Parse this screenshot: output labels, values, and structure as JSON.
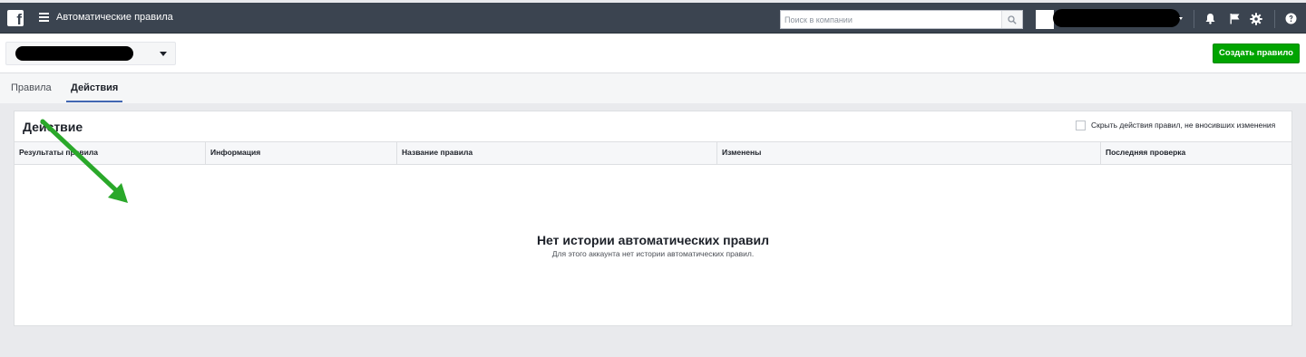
{
  "topbar": {
    "logo_letter": "f",
    "app_title": "Автоматические правила",
    "search_placeholder": "Поиск в компании"
  },
  "account_bar": {
    "create_button": "Создать правило"
  },
  "tabs": [
    {
      "label": "Правила",
      "active": false
    },
    {
      "label": "Действия",
      "active": true
    }
  ],
  "panel": {
    "title": "Действие",
    "hide_option": "Скрыть действия правил, не вносивших изменения",
    "columns": [
      "Результаты правила",
      "Информация",
      "Название правила",
      "Изменены",
      "Последняя проверка"
    ],
    "empty_title": "Нет истории автоматических правил",
    "empty_subtitle": "Для этого аккаунта нет истории автоматических правил."
  },
  "colors": {
    "topbar": "#3b4450",
    "create_button": "#00a400",
    "tab_accent": "#4267b2",
    "annotation_arrow": "#2aa82a"
  }
}
